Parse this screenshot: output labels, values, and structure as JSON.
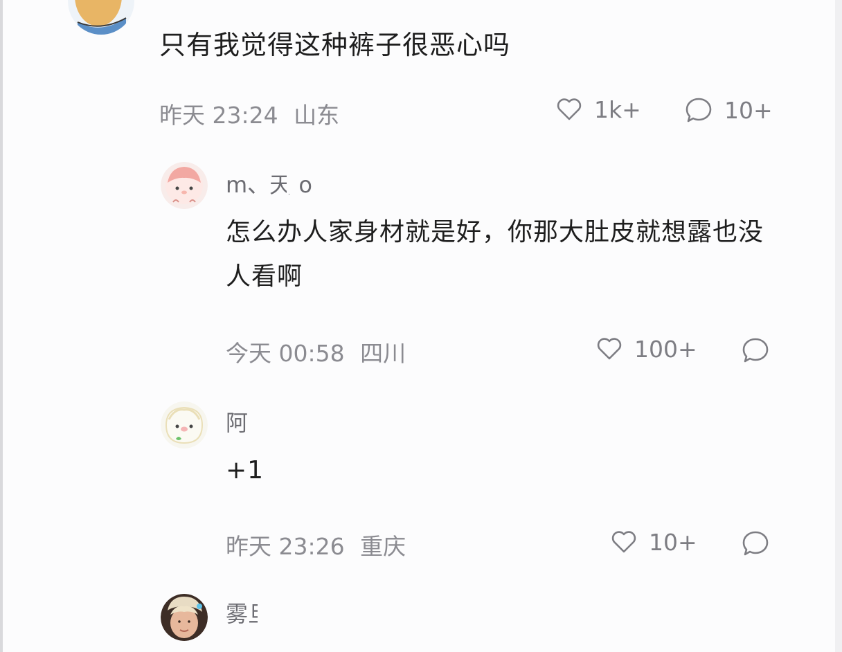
{
  "post": {
    "text": "只有我觉得这种裤子很恶心吗",
    "time": "昨天 23:24",
    "location": "山东",
    "likes": "1k+",
    "comments": "10+"
  },
  "replies": [
    {
      "username": "m、天  o",
      "text": "怎么办人家身材就是好，你那大肚皮就想露也没人看啊",
      "time": "今天 00:58",
      "location": "四川",
      "likes": "100+"
    },
    {
      "username": "阿",
      "text": "+1",
      "time": "昨天 23:26",
      "location": "重庆",
      "likes": "10+"
    },
    {
      "username": "雾旦"
    }
  ],
  "icons": {
    "like": "heart-outline-icon",
    "comment": "speech-bubble-icon"
  },
  "colors": {
    "text": "#1e1e1e",
    "meta": "#8b8b91",
    "icon": "#7d7d83"
  }
}
